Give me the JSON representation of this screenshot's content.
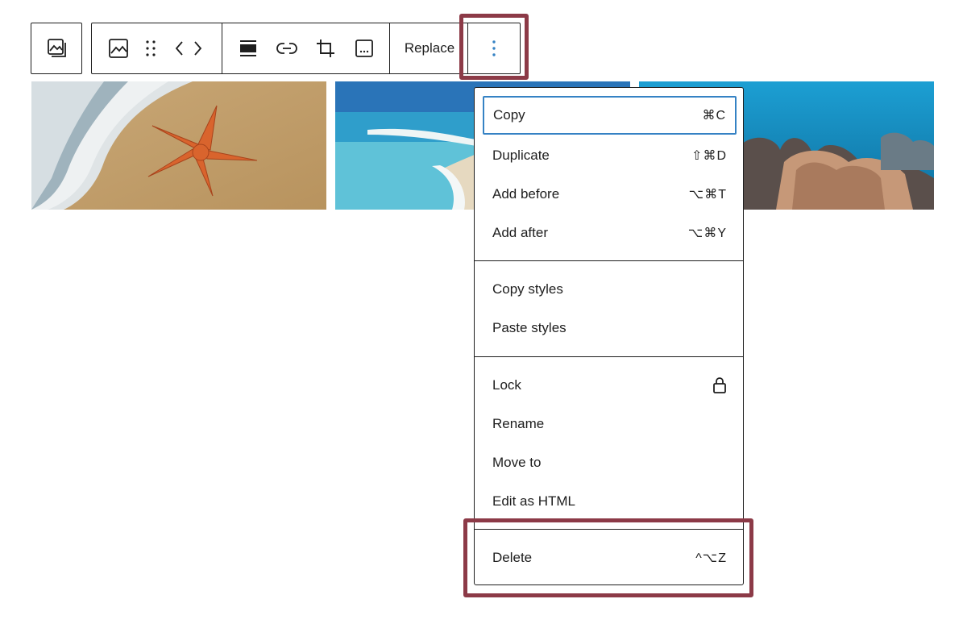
{
  "toolbar": {
    "single_icon": "gallery-icon",
    "icons": [
      "image-icon",
      "drag-handle-icon",
      "chevron-left-icon",
      "chevron-right-icon",
      "align-icon",
      "link-icon",
      "crop-icon",
      "caption-icon"
    ],
    "replace_label": "Replace",
    "more_icon": "more-vertical-icon",
    "more_icon_color": "#3582c4"
  },
  "images": [
    {
      "name": "starfish-on-beach"
    },
    {
      "name": "tropical-beach-shore"
    },
    {
      "name": "coral-reef-underwater"
    }
  ],
  "menu": {
    "groups": [
      [
        {
          "label": "Copy",
          "shortcut": "⌘C"
        },
        {
          "label": "Duplicate",
          "shortcut": "⇧⌘D"
        },
        {
          "label": "Add before",
          "shortcut": "⌥⌘T"
        },
        {
          "label": "Add after",
          "shortcut": "⌥⌘Y"
        }
      ],
      [
        {
          "label": "Copy styles"
        },
        {
          "label": "Paste styles"
        }
      ],
      [
        {
          "label": "Lock",
          "icon": "lock-icon"
        },
        {
          "label": "Rename"
        },
        {
          "label": "Move to"
        },
        {
          "label": "Edit as HTML"
        }
      ],
      [
        {
          "label": "Delete",
          "shortcut": "^⌥Z"
        }
      ]
    ]
  },
  "colors": {
    "highlight": "#8c3a47",
    "focus": "#3582c4",
    "border": "#1e1e1e"
  }
}
